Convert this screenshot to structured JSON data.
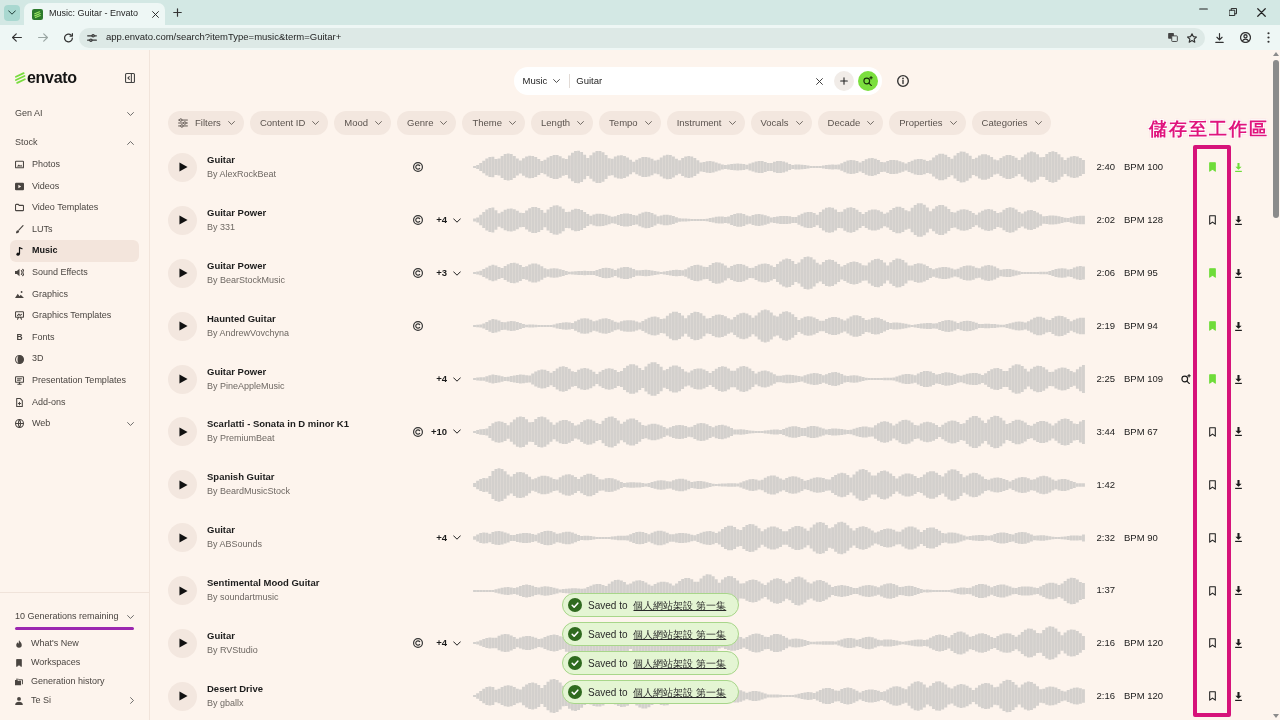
{
  "browser": {
    "tab_title": "Music: Guitar - Envato",
    "url": "app.envato.com/search?itemType=music&term=Guitar+"
  },
  "sidebar": {
    "logo": "envato",
    "sections": [
      {
        "label": "Gen AI",
        "expanded": false
      },
      {
        "label": "Stock",
        "expanded": true,
        "items": [
          {
            "label": "Photos",
            "kind": "link",
            "selected": false
          },
          {
            "label": "Videos",
            "kind": "link",
            "selected": false
          },
          {
            "label": "Video Templates",
            "kind": "link",
            "selected": false
          },
          {
            "label": "LUTs",
            "kind": "link",
            "selected": false
          },
          {
            "label": "Music",
            "kind": "link",
            "selected": true
          },
          {
            "label": "Sound Effects",
            "kind": "link",
            "selected": false
          },
          {
            "label": "Graphics",
            "kind": "link",
            "selected": false
          },
          {
            "label": "Graphics Templates",
            "kind": "link",
            "selected": false
          },
          {
            "label": "Fonts",
            "kind": "link",
            "selected": false,
            "glyph": "B"
          },
          {
            "label": "3D",
            "kind": "link",
            "selected": false
          },
          {
            "label": "Presentation Templates",
            "kind": "link",
            "selected": false
          },
          {
            "label": "Add-ons",
            "kind": "link",
            "selected": false
          },
          {
            "label": "Web",
            "kind": "group",
            "selected": false,
            "expanded": false
          }
        ]
      }
    ],
    "credits": {
      "label": "10 Generations remaining",
      "expanded": false,
      "level": 1
    },
    "footer_items": [
      {
        "label": "What's New",
        "kind": "link"
      },
      {
        "label": "Workspaces",
        "kind": "link"
      },
      {
        "label": "Generation history",
        "kind": "link"
      },
      {
        "label": "Te Si",
        "kind": "account"
      }
    ]
  },
  "search": {
    "category": "Music",
    "value": "Guitar"
  },
  "filters_button": "Filters",
  "filters": [
    "Content ID",
    "Mood",
    "Genre",
    "Theme",
    "Length",
    "Tempo",
    "Instrument",
    "Vocals",
    "Decade",
    "Properties",
    "Categories"
  ],
  "tracks": [
    {
      "title": "Guitar",
      "author": "By AlexRockBeat",
      "content_id": true,
      "duration": "2:40",
      "bpm": "BPM 100",
      "saved": true,
      "downloaded": true,
      "hovered": false
    },
    {
      "title": "Guitar Power",
      "author": "By 331",
      "content_id": true,
      "variations": "+4",
      "duration": "2:02",
      "bpm": "BPM 128",
      "saved": false,
      "downloaded": false,
      "hovered": false
    },
    {
      "title": "Guitar Power",
      "author": "By BearStockMusic",
      "content_id": true,
      "variations": "+3",
      "duration": "2:06",
      "bpm": "BPM 95",
      "saved": true,
      "downloaded": false,
      "hovered": false
    },
    {
      "title": "Haunted Guitar",
      "author": "By AndrewVovchyna",
      "content_id": true,
      "duration": "2:19",
      "bpm": "BPM 94",
      "saved": true,
      "downloaded": false,
      "hovered": false
    },
    {
      "title": "Guitar Power",
      "author": "By PineAppleMusic",
      "content_id": false,
      "variations": "+4",
      "duration": "2:25",
      "bpm": "BPM 109",
      "saved": true,
      "downloaded": false,
      "hovered": true
    },
    {
      "title": "Scarlatti - Sonata in D minor K1",
      "author": "By PremiumBeat",
      "content_id": true,
      "variations": "+10",
      "duration": "3:44",
      "bpm": "BPM 67",
      "saved": false,
      "downloaded": false,
      "hovered": false
    },
    {
      "title": "Spanish Guitar",
      "author": "By BeardMusicStock",
      "content_id": false,
      "duration": "1:42",
      "saved": false,
      "downloaded": false,
      "hovered": false
    },
    {
      "title": "Guitar",
      "author": "By ABSounds",
      "content_id": false,
      "variations": "+4",
      "duration": "2:32",
      "bpm": "BPM 90",
      "saved": false,
      "downloaded": false,
      "hovered": false
    },
    {
      "title": "Sentimental Mood Guitar",
      "author": "By soundartmusic",
      "content_id": false,
      "duration": "1:37",
      "saved": false,
      "downloaded": false,
      "hovered": false
    },
    {
      "title": "Guitar",
      "author": "By RVStudio",
      "content_id": true,
      "variations": "+4",
      "duration": "2:16",
      "bpm": "BPM 120",
      "saved": false,
      "downloaded": false,
      "hovered": false
    },
    {
      "title": "Desert Drive",
      "author": "By gballx",
      "content_id": false,
      "duration": "2:16",
      "bpm": "BPM 120",
      "saved": false,
      "downloaded": false,
      "hovered": false
    }
  ],
  "toasts": [
    {
      "text": "Saved to",
      "link": "個人網站架設 第一集"
    },
    {
      "text": "Saved to",
      "link": "個人網站架設 第一集"
    },
    {
      "text": "Saved to",
      "link": "個人網站架設 第一集"
    },
    {
      "text": "Saved to",
      "link": "個人網站架設 第一集"
    }
  ],
  "annotation": {
    "label": "儲存至工作區"
  }
}
